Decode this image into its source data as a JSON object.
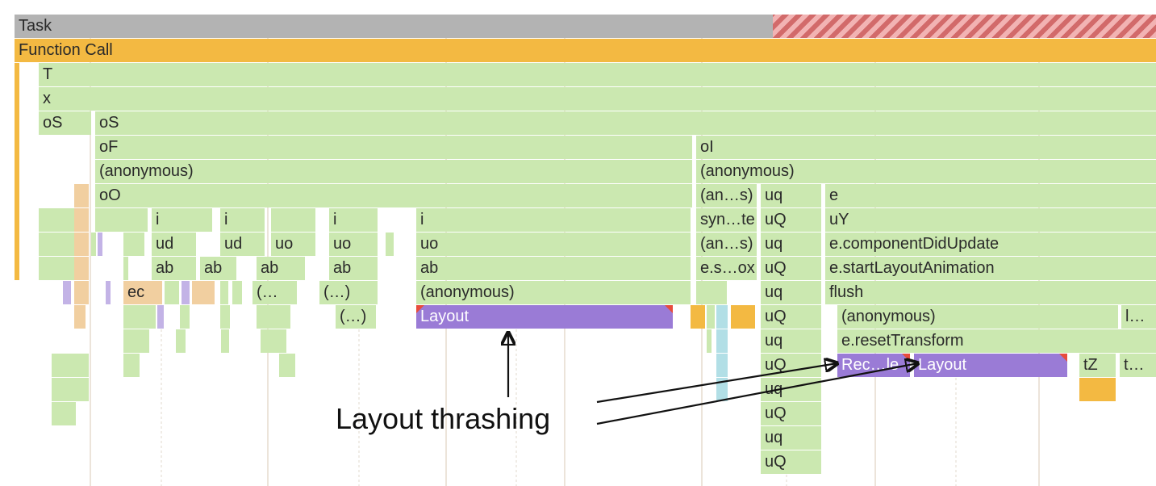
{
  "colors": {
    "task": "#b3b3b3",
    "task_stripe_a": "#f2b3b3",
    "task_stripe_b": "#d26a6a",
    "js": "#f3b942",
    "call": "#cbe8b0",
    "layout": "#9a7bd6",
    "paint_blue": "#b2dfe6",
    "orange": "#f1cfa0",
    "warn_triangle": "#e74c3c"
  },
  "annotation": {
    "text": "Layout thrashing"
  },
  "bars": {
    "task": "Task",
    "function_call": "Function Call",
    "r2": {
      "T": "T"
    },
    "r3": {
      "x": "x"
    },
    "r4": {
      "oS_a": "oS",
      "oS_b": "oS"
    },
    "r5": {
      "oF": "oF",
      "oI": "oI"
    },
    "r6": {
      "anon_a": "(anonymous)",
      "anon_b": "(anonymous)"
    },
    "r7": {
      "oO": "oO",
      "an_s": "(an…s)",
      "uq": "uq",
      "e": "e"
    },
    "r8": {
      "i1": "i",
      "i2": "i",
      "i3": "i",
      "i4": "i",
      "syn": "syn…te",
      "uQ": "uQ",
      "uY": "uY"
    },
    "r9": {
      "ud1": "ud",
      "ud2": "ud",
      "uo1": "uo",
      "uo2": "uo",
      "uo3": "uo",
      "an_s": "(an…s)",
      "uq": "uq",
      "cdu": "e.componentDidUpdate"
    },
    "r10": {
      "ab1": "ab",
      "ab2": "ab",
      "ab3": "ab",
      "ab4": "ab",
      "ab5": "ab",
      "esox": "e.s…ox",
      "uQ": "uQ",
      "sla": "e.startLayoutAnimation"
    },
    "r11": {
      "ec": "ec",
      "p1": "(…",
      "p2": "(…)",
      "anon": "(anonymous)",
      "uq": "uq",
      "flush": "flush"
    },
    "r12": {
      "p1": "(…)",
      "layout": "Layout",
      "uQ": "uQ",
      "anon": "(anonymous)",
      "l": "l…"
    },
    "r13": {
      "uq": "uq",
      "ert": "e.resetTransform"
    },
    "r14": {
      "uQ": "uQ",
      "rec": "Rec…le",
      "layout": "Layout",
      "tZ": "tZ",
      "t": "t…"
    },
    "r15": {
      "uq": "uq"
    },
    "r16": {
      "uQ": "uQ"
    },
    "r17": {
      "uq": "uq"
    },
    "r18": {
      "uQ": "uQ"
    }
  }
}
